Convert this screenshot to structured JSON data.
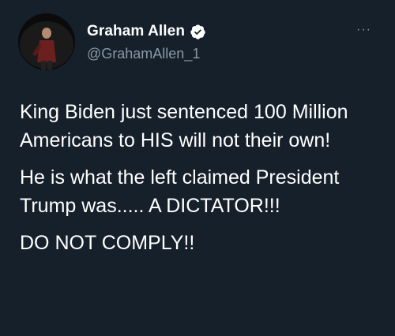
{
  "author": {
    "display_name": "Graham Allen",
    "handle": "@GrahamAllen_1",
    "verified_icon": "verified-badge-icon",
    "avatar_icon": "profile-photo"
  },
  "menu": {
    "more_label": "···",
    "more_icon": "more-options-icon"
  },
  "tweet": {
    "paragraphs": [
      "King Biden just sentenced 100 Million Americans to HIS will not their own!",
      "He is what the left claimed President Trump was..... A DICTATOR!!!",
      "DO NOT COMPLY!!"
    ]
  },
  "colors": {
    "background": "#15202b",
    "text": "#ffffff",
    "secondary_text": "#8b98a5",
    "verified": "#ffffff"
  }
}
